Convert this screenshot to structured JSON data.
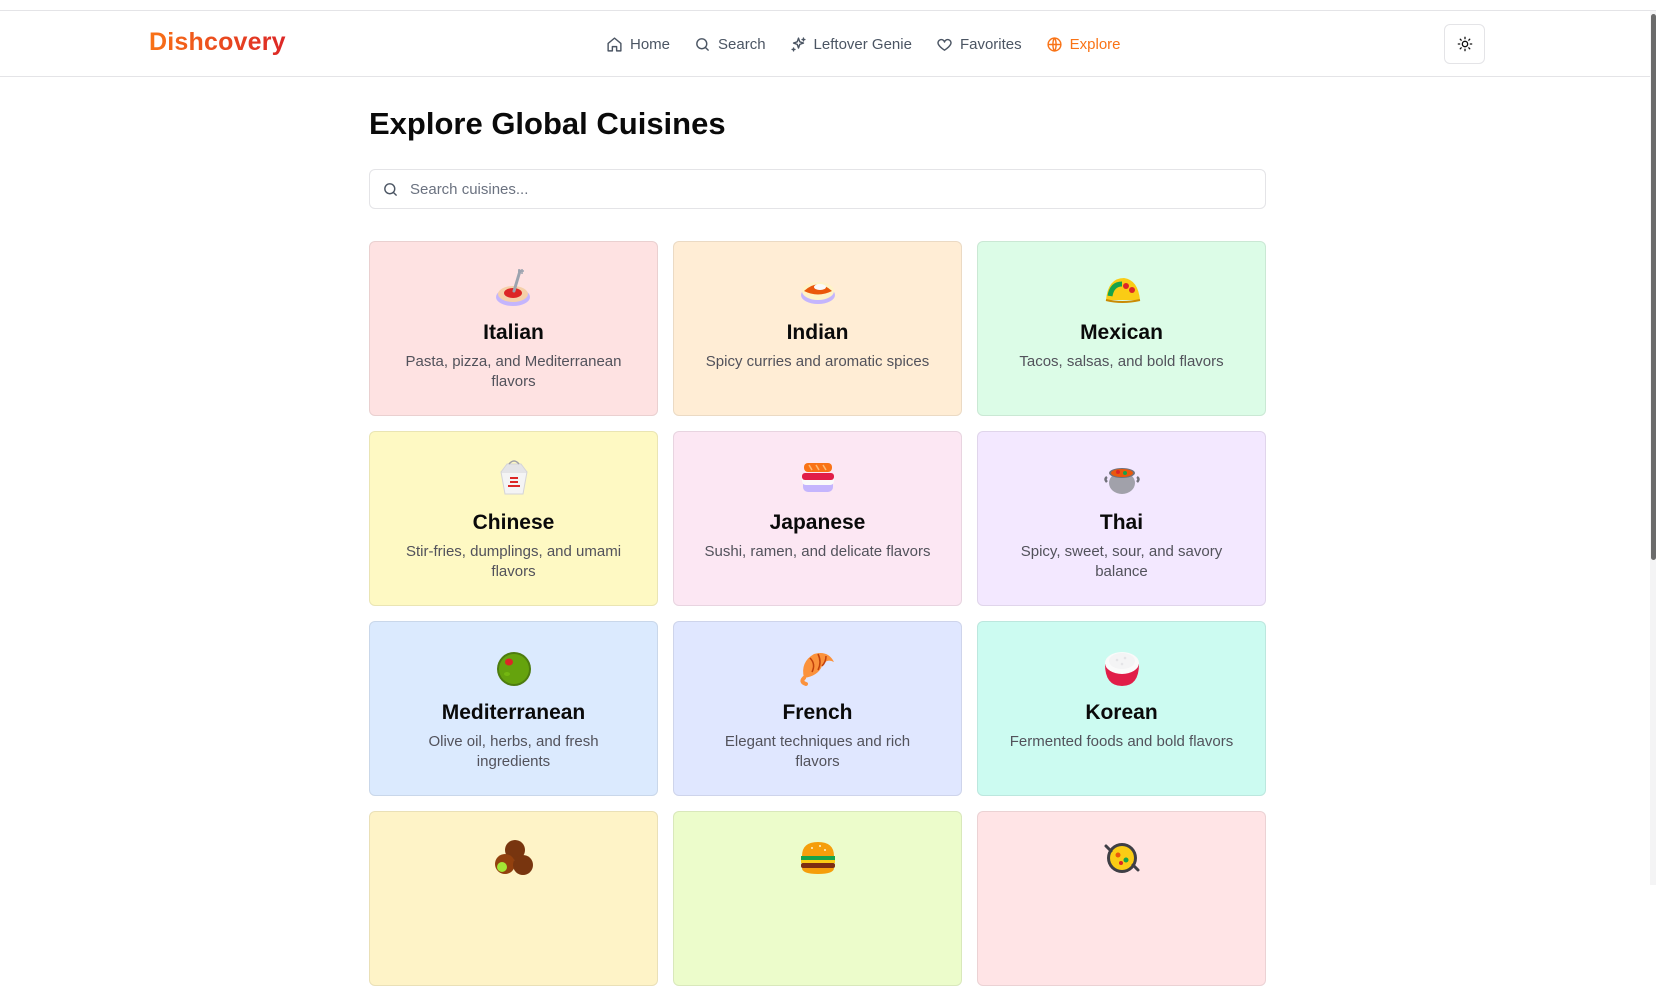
{
  "brand": {
    "name": "Dishcovery"
  },
  "nav": {
    "items": [
      {
        "label": "Home",
        "icon": "home-icon"
      },
      {
        "label": "Search",
        "icon": "search-icon"
      },
      {
        "label": "Leftover Genie",
        "icon": "sparkles-icon"
      },
      {
        "label": "Favorites",
        "icon": "heart-icon"
      },
      {
        "label": "Explore",
        "icon": "globe-icon",
        "active": true
      }
    ],
    "active_color": "#f97316"
  },
  "theme_toggle": {
    "icon": "sun-icon"
  },
  "page": {
    "title": "Explore Global Cuisines",
    "search_placeholder": "Search cuisines..."
  },
  "cuisines": [
    {
      "name": "Italian",
      "description": "Pasta, pizza, and Mediterranean flavors",
      "icon": "spaghetti-icon",
      "bg": "#fee2e2"
    },
    {
      "name": "Indian",
      "description": "Spicy curries and aromatic spices",
      "icon": "curry-rice-icon",
      "bg": "#ffedd5"
    },
    {
      "name": "Mexican",
      "description": "Tacos, salsas, and bold flavors",
      "icon": "taco-icon",
      "bg": "#dcfce7"
    },
    {
      "name": "Chinese",
      "description": "Stir-fries, dumplings, and umami flavors",
      "icon": "takeout-box-icon",
      "bg": "#fef9c3"
    },
    {
      "name": "Japanese",
      "description": "Sushi, ramen, and delicate flavors",
      "icon": "sushi-icon",
      "bg": "#fce7f3"
    },
    {
      "name": "Thai",
      "description": "Spicy, sweet, sour, and savory balance",
      "icon": "pot-of-food-icon",
      "bg": "#f3e8ff"
    },
    {
      "name": "Mediterranean",
      "description": "Olive oil, herbs, and fresh ingredients",
      "icon": "olive-icon",
      "bg": "#dbeafe"
    },
    {
      "name": "French",
      "description": "Elegant techniques and rich flavors",
      "icon": "croissant-icon",
      "bg": "#e0e7ff"
    },
    {
      "name": "Korean",
      "description": "Fermented foods and bold flavors",
      "icon": "rice-bowl-icon",
      "bg": "#ccfbf1"
    },
    {
      "name": "",
      "description": "",
      "icon": "falafel-icon",
      "bg": "#fef3c7"
    },
    {
      "name": "",
      "description": "",
      "icon": "hamburger-icon",
      "bg": "#ecfccb"
    },
    {
      "name": "",
      "description": "",
      "icon": "paella-icon",
      "bg": "#ffe4e6"
    }
  ]
}
